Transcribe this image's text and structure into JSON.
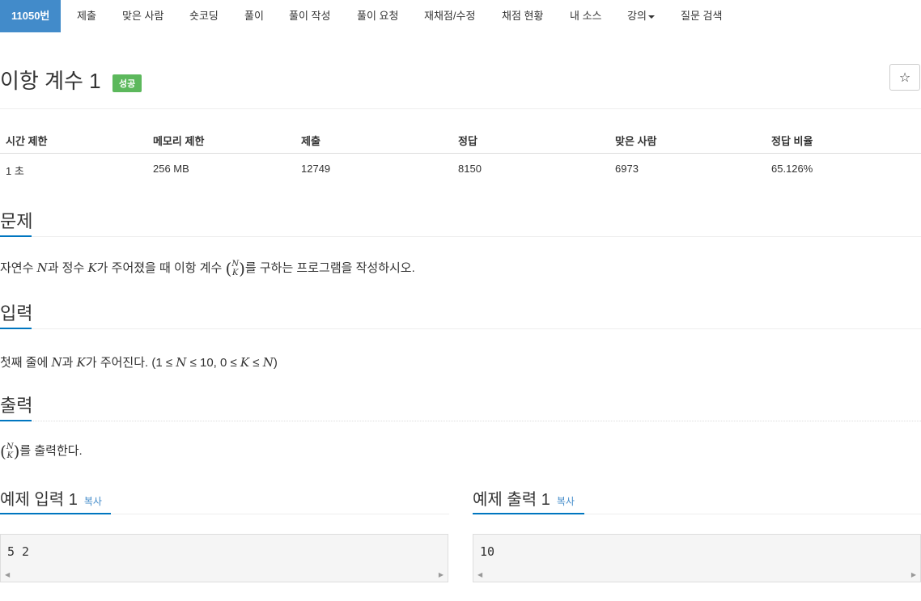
{
  "nav": {
    "items": [
      {
        "label": "11050번",
        "active": true
      },
      {
        "label": "제출"
      },
      {
        "label": "맞은 사람"
      },
      {
        "label": "숏코딩"
      },
      {
        "label": "풀이"
      },
      {
        "label": "풀이 작성"
      },
      {
        "label": "풀이 요청"
      },
      {
        "label": "재채점/수정"
      },
      {
        "label": "채점 현황"
      },
      {
        "label": "내 소스"
      },
      {
        "label": "강의"
      },
      {
        "label": "질문 검색"
      }
    ]
  },
  "problem": {
    "title": "이항 계수 1",
    "badge": "성공",
    "star": "☆"
  },
  "info_table": {
    "headers": [
      "시간 제한",
      "메모리 제한",
      "제출",
      "정답",
      "맞은 사람",
      "정답 비율"
    ],
    "values": [
      "1 초",
      "256 MB",
      "12749",
      "8150",
      "6973",
      "65.126%"
    ]
  },
  "sections": {
    "problem": {
      "heading": "문제",
      "t1": "자연수 ",
      "v1": "N",
      "t2": "과 정수 ",
      "v2": "K",
      "t3": "가 주어졌을 때 이항 계수 ",
      "t4": "를 구하는 프로그램을 작성하시오."
    },
    "input": {
      "heading": "입력",
      "t1": "첫째 줄에 ",
      "v1": "N",
      "t2": "과 ",
      "v2": "K",
      "t3": "가 주어진다. (1 ≤ ",
      "v3": "N",
      "t4": " ≤ 10, 0 ≤ ",
      "v4": "K",
      "t5": " ≤ ",
      "v5": "N",
      "t6": ")"
    },
    "output": {
      "heading": "출력",
      "t1": "를 출력한다."
    }
  },
  "binom": {
    "top": "N",
    "bottom": "K"
  },
  "examples": {
    "input": {
      "heading": "예제 입력 1",
      "copy": "복사",
      "content": "5 2"
    },
    "output": {
      "heading": "예제 출력 1",
      "copy": "복사",
      "content": "10"
    }
  },
  "colors": {
    "primary": "#428bca",
    "success": "#5cb85c",
    "underline": "#0076c0"
  }
}
